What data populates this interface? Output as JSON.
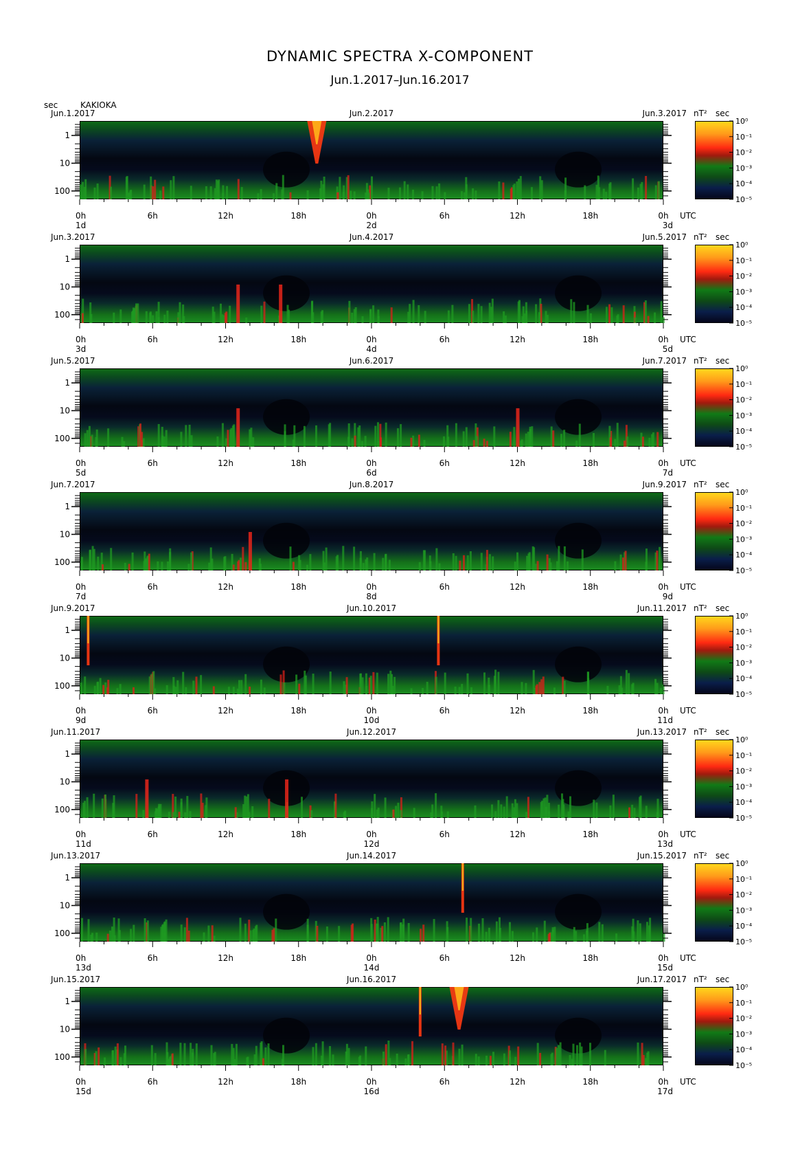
{
  "title": "DYNAMIC SPECTRA X-COMPONENT",
  "subtitle": "Jun.1.2017–Jun.16.2017",
  "y_unit": "sec",
  "station": "KAKIOKA",
  "colorbar_unit": "nT²sec",
  "time_unit_label": "UTC",
  "colors": {
    "background": "#ffffff",
    "low_power": "#05061a",
    "mid_power": "#117a16",
    "high_power": "#ff2a12",
    "max_power": "#ffd71c"
  },
  "chart_data": {
    "type": "heatmap",
    "description_scale": "log",
    "y_axis": {
      "label": "sec",
      "ticks": [
        "1",
        "10",
        "100"
      ],
      "scale": "log",
      "inverted": true
    },
    "x_axis": {
      "ticks": [
        "0h",
        "6h",
        "12h",
        "18h",
        "0h",
        "6h",
        "12h",
        "18h",
        "0h"
      ],
      "unit": "UTC"
    },
    "colorbar": {
      "label": "nT²sec",
      "ticks": [
        "10⁰",
        "10⁻¹",
        "10⁻²",
        "10⁻³",
        "10⁻⁴",
        "10⁻⁵"
      ]
    },
    "panels": [
      {
        "start": "Jun.1.2017",
        "mid": "Jun.2.2017",
        "end": "Jun.3.2017",
        "days": [
          "1d",
          "2d",
          "3d"
        ],
        "events": [
          {
            "h": 19.5,
            "type": "broad"
          }
        ]
      },
      {
        "start": "Jun.3.2017",
        "mid": "Jun.4.2017",
        "end": "Jun.5.2017",
        "days": [
          "3d",
          "4d",
          "5d"
        ],
        "events": [
          {
            "h": 13.0,
            "type": "burst"
          },
          {
            "h": 16.5,
            "type": "burst"
          }
        ]
      },
      {
        "start": "Jun.5.2017",
        "mid": "Jun.6.2017",
        "end": "Jun.7.2017",
        "days": [
          "5d",
          "6d",
          "7d"
        ],
        "events": [
          {
            "h": 13.0,
            "type": "burst"
          },
          {
            "h": 36.0,
            "type": "burst"
          }
        ]
      },
      {
        "start": "Jun.7.2017",
        "mid": "Jun.8.2017",
        "end": "Jun.9.2017",
        "days": [
          "7d",
          "8d",
          "9d"
        ],
        "events": [
          {
            "h": 14.0,
            "type": "burst"
          }
        ]
      },
      {
        "start": "Jun.9.2017",
        "mid": "Jun.10.2017",
        "end": "Jun.11.2017",
        "days": [
          "9d",
          "10d",
          "11d"
        ],
        "events": [
          {
            "h": 0.7,
            "type": "narrow"
          },
          {
            "h": 29.5,
            "type": "narrow"
          }
        ]
      },
      {
        "start": "Jun.11.2017",
        "mid": "Jun.12.2017",
        "end": "Jun.13.2017",
        "days": [
          "11d",
          "12d",
          "13d"
        ],
        "events": [
          {
            "h": 17.0,
            "type": "burst"
          },
          {
            "h": 5.5,
            "type": "burst"
          }
        ]
      },
      {
        "start": "Jun.13.2017",
        "mid": "Jun.14.2017",
        "end": "Jun.15.2017",
        "days": [
          "13d",
          "14d",
          "15d"
        ],
        "events": [
          {
            "h": 31.5,
            "type": "narrow"
          }
        ]
      },
      {
        "start": "Jun.15.2017",
        "mid": "Jun.16.2017",
        "end": "Jun.17.2017",
        "days": [
          "15d",
          "16d",
          "17d"
        ],
        "events": [
          {
            "h": 31.2,
            "type": "broad"
          },
          {
            "h": 28.0,
            "type": "narrow"
          }
        ]
      }
    ]
  }
}
